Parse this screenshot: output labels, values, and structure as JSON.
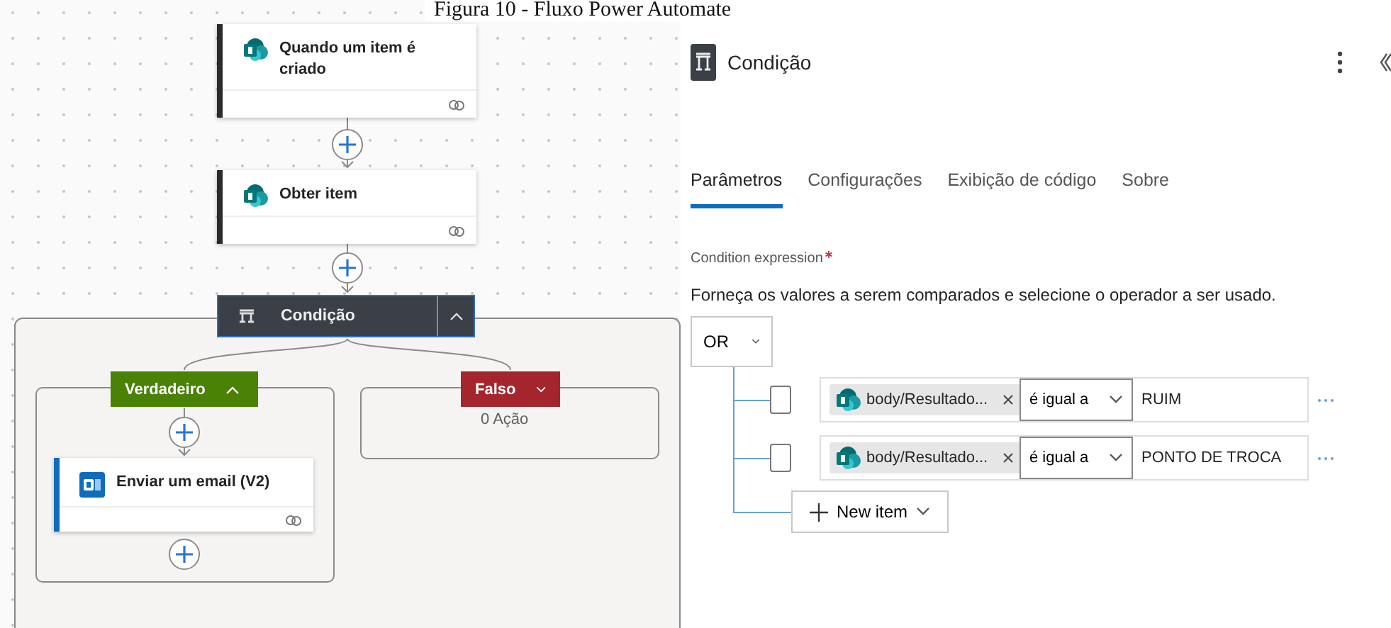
{
  "caption": "Figura 10 - Fluxo Power Automate",
  "flow": {
    "steps": [
      {
        "title": "Quando um item é criado",
        "kind": "sharepoint"
      },
      {
        "title": "Obter item",
        "kind": "sharepoint"
      }
    ],
    "condition": {
      "title": "Condição",
      "expanded": true,
      "branches": [
        {
          "label": "Verdadeiro",
          "kind": "true",
          "expanded": true,
          "actions": [
            {
              "title": "Enviar um email (V2)",
              "kind": "outlook"
            }
          ]
        },
        {
          "label": "Falso",
          "kind": "false",
          "expanded": false,
          "summary": "0 Ação"
        }
      ]
    }
  },
  "panel": {
    "title": "Condição",
    "tabs": [
      {
        "label": "Parâmetros",
        "selected": true
      },
      {
        "label": "Configurações",
        "selected": false
      },
      {
        "label": "Exibição de código",
        "selected": false
      },
      {
        "label": "Sobre",
        "selected": false
      }
    ],
    "field_label": "Condition expression",
    "required": true,
    "description": "Forneça os valores a serem comparados e selecione o operador a ser usado.",
    "group_operator": "OR",
    "rows": [
      {
        "checked": false,
        "token": "body/Resultado...",
        "operator": "é igual a",
        "value": "RUIM"
      },
      {
        "checked": false,
        "token": "body/Resultado...",
        "operator": "é igual a",
        "value": "PONTO DE TROCA"
      }
    ],
    "add_button": "New item"
  }
}
